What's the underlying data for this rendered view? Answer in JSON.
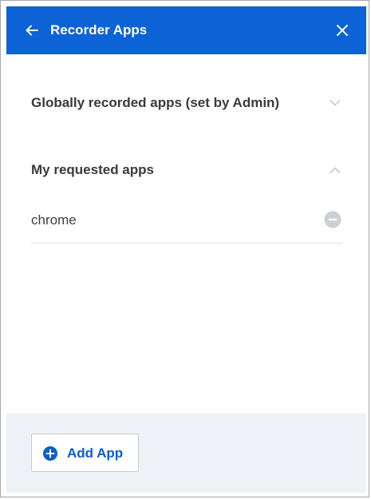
{
  "header": {
    "title": "Recorder Apps",
    "back_icon": "arrow-left-icon",
    "close_icon": "close-icon",
    "background_color": "#0b63d6"
  },
  "sections": [
    {
      "title": "Globally recorded apps (set by Admin)",
      "state": "collapsed",
      "chevron_icon": "chevron-down-icon"
    },
    {
      "title": "My requested apps",
      "state": "expanded",
      "chevron_icon": "chevron-up-icon",
      "apps": [
        {
          "name": "chrome",
          "action_icon": "remove-circle-icon"
        }
      ]
    }
  ],
  "footer": {
    "add_button_label": "Add App",
    "add_icon": "plus-circle-icon",
    "accent_color": "#0b5fc8"
  }
}
